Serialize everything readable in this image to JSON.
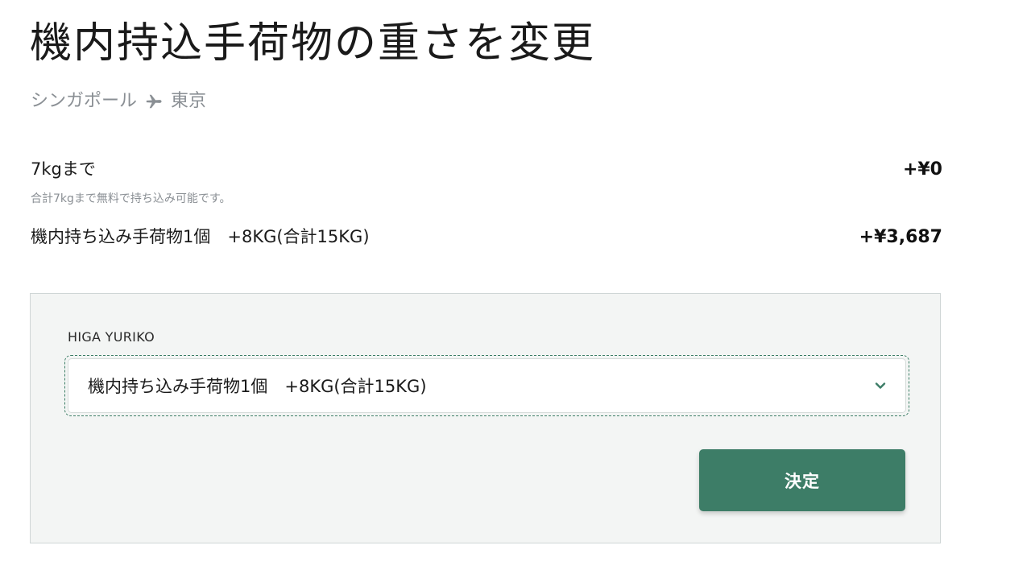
{
  "page": {
    "title": "機内持込手荷物の重さを変更"
  },
  "route": {
    "origin": "シンガポール",
    "destination": "東京",
    "separator_icon": "plane-icon"
  },
  "options": [
    {
      "label": "7kgまで",
      "price": "+¥0",
      "note": "合計7kgまで無料で持ち込み可能です。"
    },
    {
      "label": "機内持ち込み手荷物1個　+8KG(合計15KG)",
      "price": "+¥3,687"
    }
  ],
  "passenger": {
    "name": "HIGA YURIKO",
    "selected_option": "機内持ち込み手荷物1個　+8KG(合計15KG)"
  },
  "actions": {
    "confirm_label": "決定"
  },
  "colors": {
    "accent": "#3d7d67",
    "panel_background": "#f3f5f4",
    "muted_text": "#8a8f94"
  }
}
